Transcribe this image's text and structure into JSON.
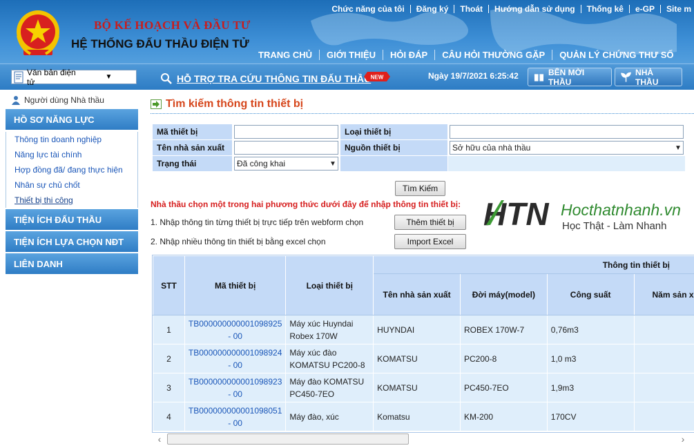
{
  "header": {
    "ministry": "BỘ KẾ HOẠCH VÀ ĐẦU TƯ",
    "system": "HỆ THỐNG ĐẤU THẦU ĐIỆN TỬ",
    "top_links": [
      "Chức năng của tôi",
      "Đăng ký",
      "Thoát",
      "Hướng dẫn sử dụng",
      "Thống kê",
      "e-GP",
      "Site m"
    ],
    "main_nav": [
      "TRANG CHỦ",
      "GIỚI THIỆU",
      "HỎI ĐÁP",
      "CÂU HỎI THƯỜNG GẶP",
      "QUẢN LÝ CHỨNG THƯ SỐ"
    ],
    "doc_select": "Văn bản điện tử",
    "support_link": "HỖ TRỢ TRA CỨU THÔNG TIN ĐẤU THẦU",
    "new_badge": "NEW",
    "datetime": "Ngày 19/7/2021 6:25:42",
    "btn_inviter": "BÊN MỜI THẦU",
    "btn_contractor": "NHÀ THẦU"
  },
  "sidebar": {
    "user": "Người dùng Nhà thầu",
    "section1": "HỒ SƠ NĂNG LỰC",
    "items": [
      "Thông tin doanh nghiệp",
      "Năng lực tài chính",
      "Hợp đồng đã/ đang thực hiện",
      "Nhân sự chủ chốt",
      "Thiết bị thi công"
    ],
    "section2": "TIỆN ÍCH ĐẤU THẦU",
    "section3": "TIỆN ÍCH LỰA CHỌN NĐT",
    "section4": "LIÊN DANH"
  },
  "main": {
    "title": "Tìm kiếm thông tin thiết bị",
    "form": {
      "ma_label": "Mã thiết bị",
      "loai_label": "Loại thiết bị",
      "nsx_label": "Tên nhà sản xuất",
      "nguon_label": "Nguồn thiết bị",
      "nguon_value": "Sở hữu của nhà thầu",
      "trangthai_label": "Trạng thái",
      "trangthai_value": "Đã công khai"
    },
    "search_button": "Tìm Kiếm",
    "instruction": "Nhà thầu chọn một trong hai phương thức dưới đây để nhập thông tin thiết bị:",
    "option1": "1. Nhập thông tin từng thiết bị trực tiếp trên webform chọn",
    "option1_button": "Thêm thiết bị",
    "option2": "2. Nhập nhiều thông tin thiết bị bằng excel chọn",
    "option2_button": "Import Excel",
    "watermark_letters": "HTN",
    "watermark_site": "Hocthatnhanh.vn",
    "watermark_slogan": "Học Thật - Làm Nhanh"
  },
  "table": {
    "group_header": "Thông tin thiết bị",
    "col_stt": "STT",
    "col_ma": "Mã thiết bị",
    "col_loai": "Loại thiết bị",
    "col_nsx": "Tên nhà sản xuất",
    "col_model": "Đời máy(model)",
    "col_power": "Công suất",
    "col_year": "Năm sản xuất",
    "rows": [
      {
        "stt": "1",
        "code": "TB000000000001098925 - 00",
        "type": "Máy xúc Huyndai Robex 170W",
        "maker": "HUYNDAI",
        "model": "ROBEX 170W-7",
        "power": "0,76m3",
        "year": ""
      },
      {
        "stt": "2",
        "code": "TB000000000001098924 - 00",
        "type": "Máy xúc đào KOMATSU PC200-8",
        "maker": "KOMATSU",
        "model": "PC200-8",
        "power": "1,0 m3",
        "year": ""
      },
      {
        "stt": "3",
        "code": "TB000000000001098923 - 00",
        "type": "Máy đào KOMATSU PC450-7EO",
        "maker": "KOMATSU",
        "model": "PC450-7EO",
        "power": "1,9m3",
        "year": ""
      },
      {
        "stt": "4",
        "code": "TB000000000001098051 - 00",
        "type": "Máy đào, xúc",
        "maker": "Komatsu",
        "model": "KM-200",
        "power": "170CV",
        "year": ""
      }
    ]
  },
  "colors": {
    "header_blue": "#2d7cc4",
    "label_bg": "#c4daf7",
    "row_bg": "#dfeefb",
    "title_orange": "#d6461b",
    "instruction_red": "#d61e1e",
    "link_blue": "#1a56b8"
  }
}
